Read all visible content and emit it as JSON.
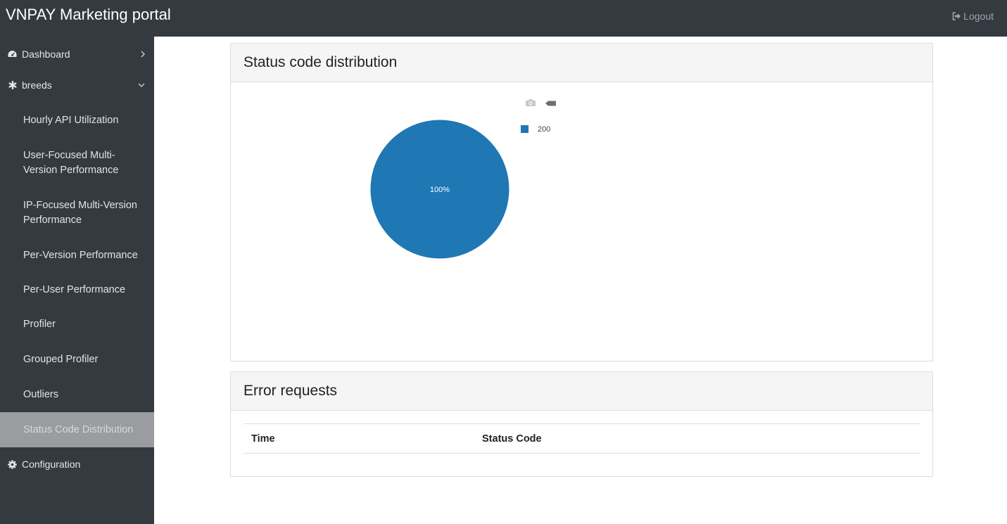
{
  "app": {
    "title": "VNPAY Marketing portal"
  },
  "header": {
    "logout_label": "Logout",
    "logout_icon": "sign-out-icon"
  },
  "sidebar": {
    "groups": [
      {
        "label": "Dashboard",
        "icon": "dashboard-icon",
        "chevron": "chevron-right-icon"
      },
      {
        "label": "breeds",
        "icon": "asterisk-icon",
        "chevron": "chevron-down-icon"
      },
      {
        "label": "Configuration",
        "icon": "gear-icon"
      }
    ],
    "items": [
      {
        "label": "Hourly API Utilization"
      },
      {
        "label": "User-Focused Multi-Version Performance"
      },
      {
        "label": "IP-Focused Multi-Version Performance"
      },
      {
        "label": "Per-Version Performance"
      },
      {
        "label": "Per-User Performance"
      },
      {
        "label": "Profiler"
      },
      {
        "label": "Grouped Profiler"
      },
      {
        "label": "Outliers"
      },
      {
        "label": "Status Code Distribution",
        "active": true
      }
    ]
  },
  "status_panel": {
    "title": "Status code distribution",
    "modebar_icons": [
      "camera-icon",
      "plotly-logo-icon"
    ]
  },
  "chart_data": {
    "type": "pie",
    "labels": [
      "200"
    ],
    "values": [
      100
    ],
    "text_labels": [
      "100%"
    ],
    "colors": [
      "#1f77b4"
    ],
    "legend": "right"
  },
  "error_panel": {
    "title": "Error requests",
    "columns": [
      "Time",
      "Status Code"
    ],
    "rows": []
  }
}
